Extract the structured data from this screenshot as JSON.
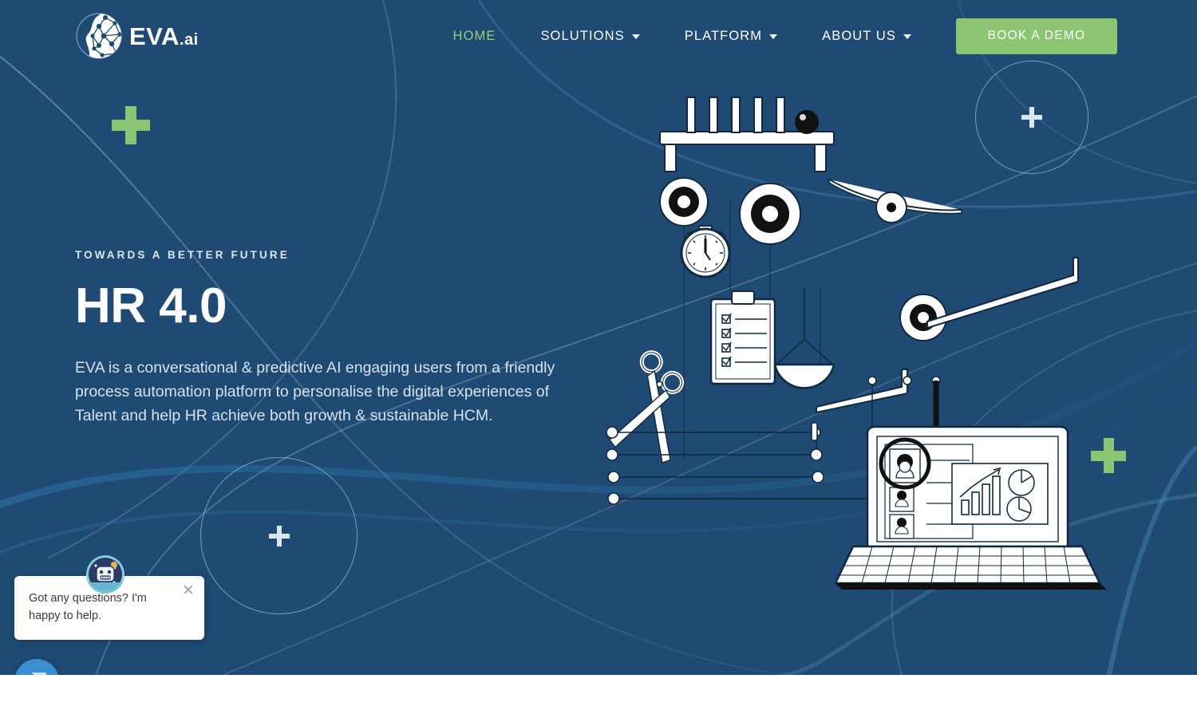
{
  "brand": {
    "logo_icon": "network-globe-icon",
    "name": "EVA",
    "suffix": ".ai"
  },
  "header": {
    "nav": [
      {
        "label": "HOME",
        "active": true,
        "has_dropdown": false,
        "icon": ""
      },
      {
        "label": "SOLUTIONS",
        "active": false,
        "has_dropdown": true,
        "icon": "chevron-down-icon"
      },
      {
        "label": "PLATFORM",
        "active": false,
        "has_dropdown": true,
        "icon": "chevron-down-icon"
      },
      {
        "label": "ABOUT US",
        "active": false,
        "has_dropdown": true,
        "icon": "chevron-down-icon"
      }
    ],
    "cta_label": "BOOK A DEMO"
  },
  "hero": {
    "eyebrow": "TOWARDS A BETTER FUTURE",
    "title": "HR 4.0",
    "subtitle": "EVA is a conversational & predictive AI engaging users from a friendly process automation platform to personalise the digital experiences of Talent and help HR achieve both growth & sustainable HCM."
  },
  "chat": {
    "message": "Got any questions? I'm happy to help.",
    "close_icon": "close-icon",
    "avatar_icon": "robot-avatar-icon",
    "launcher_icon": "chat-bubble-icon"
  },
  "decorations": {
    "plus_icon": "plus-icon",
    "circle_icon": "circle-outline-icon",
    "illustration_icon": "rube-goldberg-hr-automation-illustration"
  },
  "colors": {
    "background": "#1f4a73",
    "accent_green": "#8cc571",
    "active_nav_green": "#9acb7e",
    "chat_blue": "#3b8ed0",
    "text_white": "#ffffff",
    "body_text": "#d7e2ec"
  }
}
